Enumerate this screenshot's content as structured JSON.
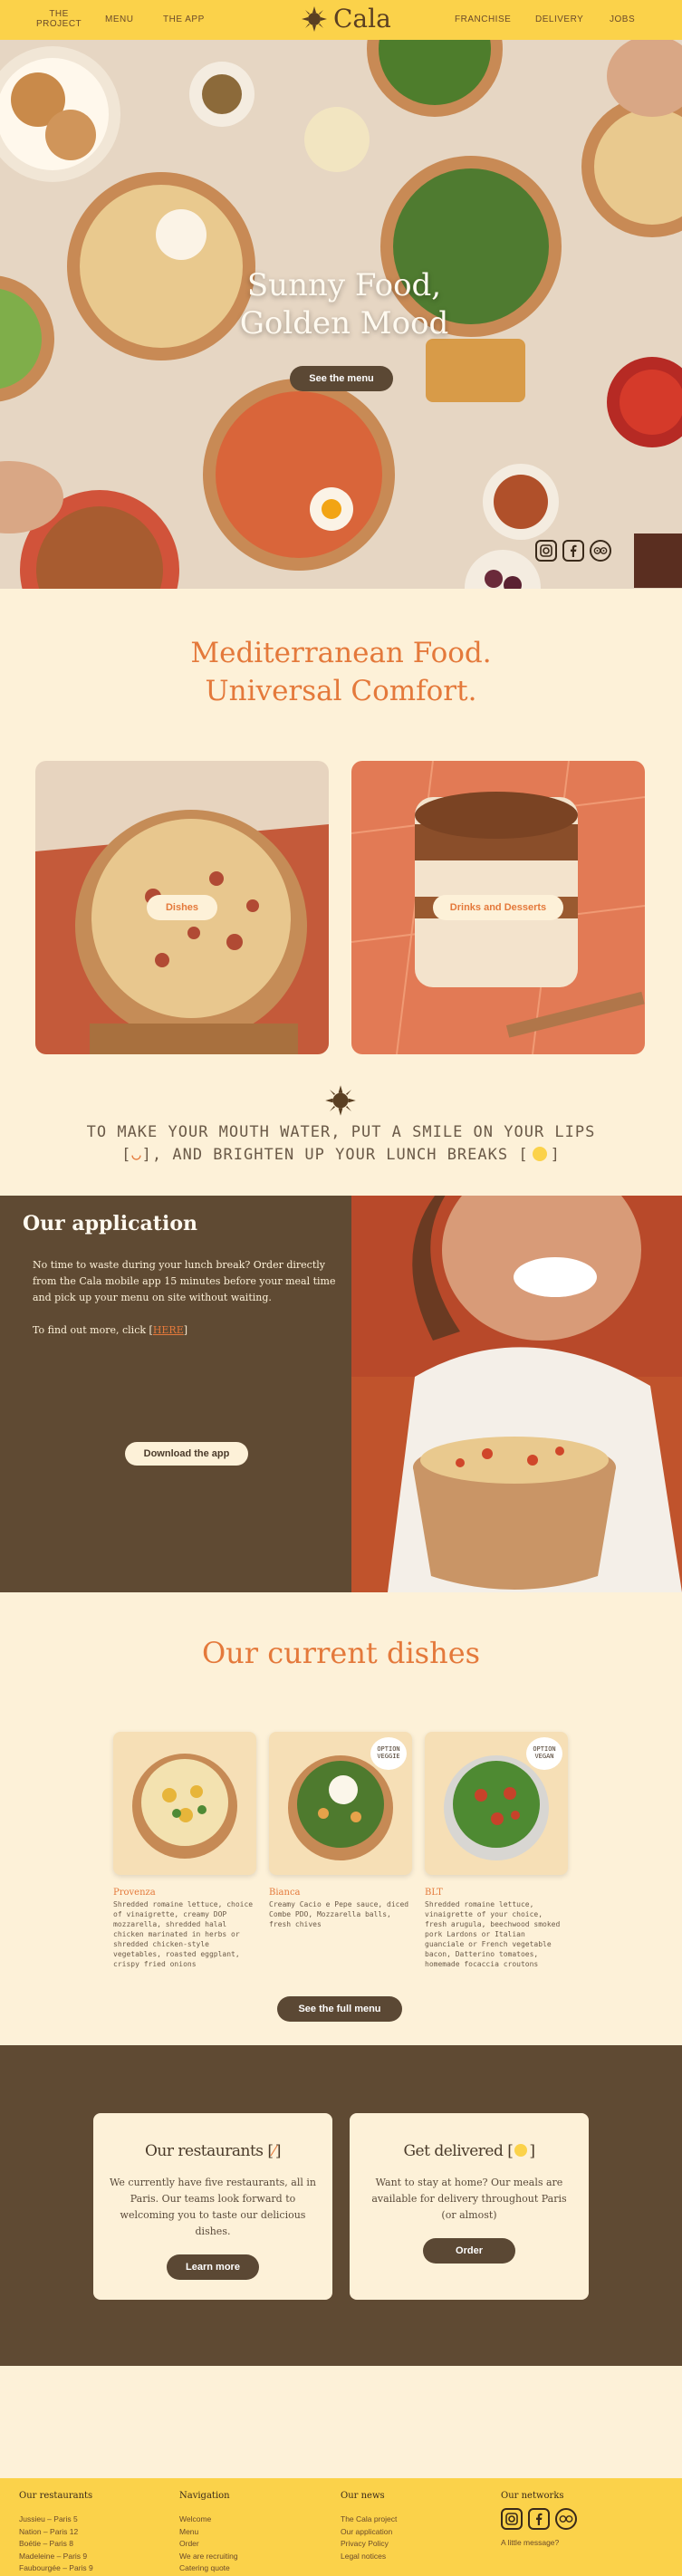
{
  "nav": {
    "project_line1": "THE",
    "project_line2": "PROJECT",
    "menu": "MENU",
    "app": "THE APP",
    "logo": "Cala",
    "franchise": "FRANCHISE",
    "delivery": "DELIVERY",
    "jobs": "JOBS"
  },
  "hero": {
    "title_line1": "Sunny Food,",
    "title_line2": "Golden Mood",
    "button": "See the menu"
  },
  "headline": {
    "line1": "Mediterranean Food.",
    "line2": "Universal Comfort."
  },
  "cards": {
    "dishes": "Dishes",
    "drinks": "Drinks and Desserts"
  },
  "tagline": {
    "line1": "TO MAKE YOUR MOUTH WATER, PUT A SMILE ON YOUR LIPS",
    "line2_a": "[",
    "line2_b": "], AND BRIGHTEN UP YOUR LUNCH BREAKS [",
    "line2_c": "]"
  },
  "app": {
    "title": "Our application",
    "text": "No time to waste during your lunch break? Order directly from the Cala mobile app 15 minutes before your meal time and pick up your menu on site without waiting.",
    "more_prefix": "To find out more, click [",
    "more_link": "HERE",
    "more_suffix": "]",
    "button": "Download the app"
  },
  "dishes": {
    "title": "Our current dishes",
    "items": [
      {
        "name": "Provenza",
        "desc": "Shredded romaine lettuce, choice of vinaigrette, creamy DOP mozzarella, shredded halal chicken marinated in herbs or shredded chicken-style vegetables, roasted eggplant, crispy fried onions"
      },
      {
        "name": "Bianca",
        "desc": "Creamy Cacio e Pepe sauce, diced Combe PDO, Mozzarella balls, fresh chives",
        "badge": "OPTION VEGGIE"
      },
      {
        "name": "BLT",
        "desc": "Shredded romaine lettuce, vinaigrette of your choice, fresh arugula, beechwood smoked pork Lardons or Italian guanciale or French vegetable bacon, Datterino tomatoes, homemade focaccia croutons",
        "badge": "OPTION VEGAN"
      }
    ],
    "button": "See the full menu"
  },
  "panels": {
    "restaurants": {
      "title_a": "Our restaurants [",
      "title_b": "]",
      "text": "We currently have five restaurants, all in Paris. Our teams look forward to welcoming you to taste our delicious dishes.",
      "button": "Learn more"
    },
    "delivery": {
      "title_a": "Get delivered [",
      "title_b": "]",
      "text": "Want to stay at home? Our meals are available for delivery throughout Paris (or almost)",
      "button": "Order"
    }
  },
  "footer": {
    "restaurants": {
      "title": "Our restaurants",
      "items": [
        "Jussieu – Paris 5",
        "Nation – Paris 12",
        "Boétie – Paris 8",
        "Madeleine – Paris 9",
        "Faubourgée – Paris 9"
      ]
    },
    "navigation": {
      "title": "Navigation",
      "items": [
        "Welcome",
        "Menu",
        "Order",
        "We are recruiting",
        "Catering quote"
      ]
    },
    "news": {
      "title": "Our news",
      "items": [
        "The Cala project",
        "Our application",
        "Privacy Policy",
        "Legal notices"
      ]
    },
    "networks": {
      "title": "Our networks",
      "message": "A little message?"
    }
  },
  "colors": {
    "accent": "#e4793b",
    "brown": "#5f4a33",
    "yellow": "#fbd24a",
    "cream": "#fdf1d8"
  },
  "icons": [
    "sun-logo-icon",
    "instagram-icon",
    "facebook-icon",
    "tripadvisor-icon",
    "smile-icon",
    "sun-icon",
    "fork-icon"
  ]
}
